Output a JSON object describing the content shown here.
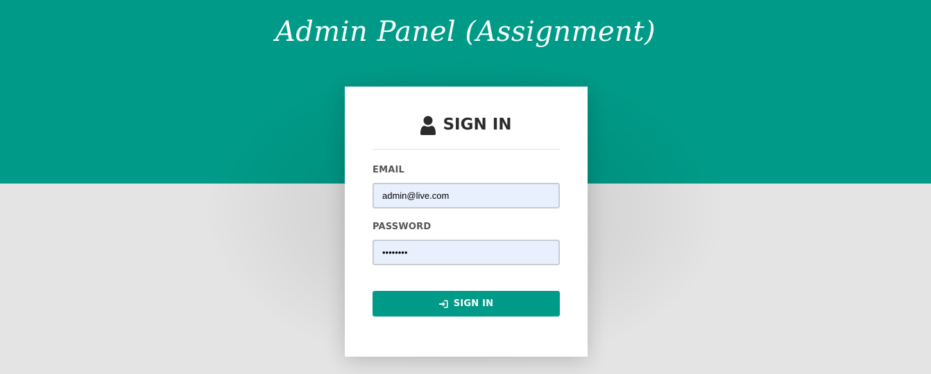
{
  "header": {
    "title": "Admin Panel (Assignment)"
  },
  "login": {
    "title": "SIGN IN",
    "title_icon": "user-icon",
    "email_label": "EMAIL",
    "email_value": "admin@live.com",
    "password_label": "PASSWORD",
    "password_value": "••••••••",
    "button_label": "SIGN IN",
    "button_icon": "sign-in-icon"
  },
  "colors": {
    "brand": "#009b88",
    "page_background": "#e4e4e4",
    "card_background": "#ffffff",
    "input_background": "#e8f0fe",
    "text_dark": "#2b2b2b",
    "label_text": "#555555"
  }
}
